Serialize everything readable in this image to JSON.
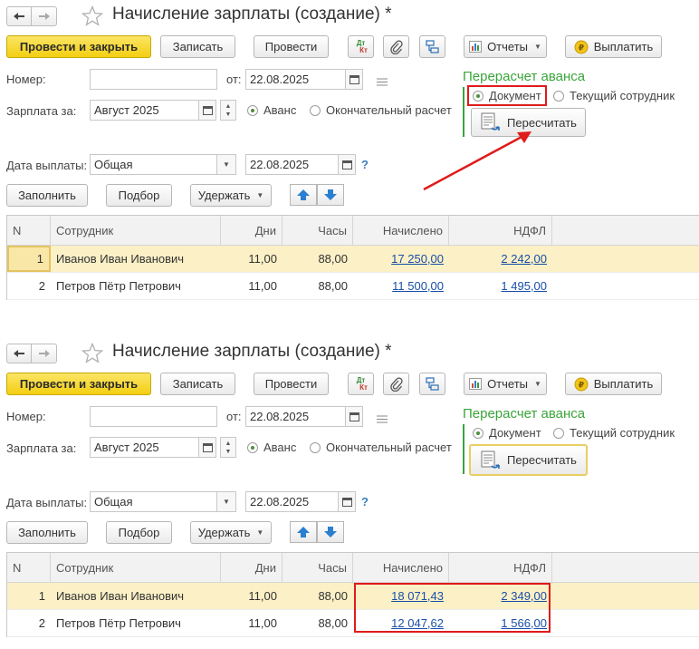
{
  "document": {
    "title": "Начисление зарплаты (создание) *",
    "toolbar": {
      "post_close": "Провести и закрыть",
      "write": "Записать",
      "post": "Провести",
      "dt_kt_top": "Дт",
      "dt_kt_bottom": "Кт",
      "reports": "Отчеты",
      "pay": "Выплатить"
    },
    "fields": {
      "number_label": "Номер:",
      "number_value": "",
      "from_label": "от:",
      "date": "22.08.2025",
      "salary_for_label": "Зарплата за:",
      "salary_month": "Август 2025",
      "option_advance": "Аванс",
      "option_final": "Окончательный расчет",
      "pay_date_label": "Дата выплаты:",
      "pay_type": "Общая",
      "pay_date": "22.08.2025",
      "help": "?"
    },
    "recalc": {
      "title": "Перерасчет аванса",
      "option_document": "Документ",
      "option_current": "Текущий сотрудник",
      "button": "Пересчитать"
    },
    "actions": {
      "fill": "Заполнить",
      "select": "Подбор",
      "withhold": "Удержать"
    },
    "table": {
      "headers": [
        "N",
        "Сотрудник",
        "Дни",
        "Часы",
        "Начислено",
        "НДФЛ"
      ]
    }
  },
  "before": {
    "rows": [
      {
        "n": "1",
        "employee": "Иванов Иван Иванович",
        "days": "11,00",
        "hours": "88,00",
        "accrued": "17 250,00",
        "ndfl": "2 242,00"
      },
      {
        "n": "2",
        "employee": "Петров Пётр Петрович",
        "days": "11,00",
        "hours": "88,00",
        "accrued": "11 500,00",
        "ndfl": "1 495,00"
      }
    ]
  },
  "after": {
    "rows": [
      {
        "n": "1",
        "employee": "Иванов Иван Иванович",
        "days": "11,00",
        "hours": "88,00",
        "accrued": "18 071,43",
        "ndfl": "2 349,00"
      },
      {
        "n": "2",
        "employee": "Петров Пётр Петрович",
        "days": "11,00",
        "hours": "88,00",
        "accrued": "12 047,62",
        "ndfl": "1 566,00"
      }
    ]
  },
  "colors": {
    "primary_button": "#f3cf12",
    "group_green": "#3aa53a",
    "annotation_red": "#e01b1b",
    "selected_row": "#fbf0c6",
    "link_blue": "#1a4fa8"
  }
}
